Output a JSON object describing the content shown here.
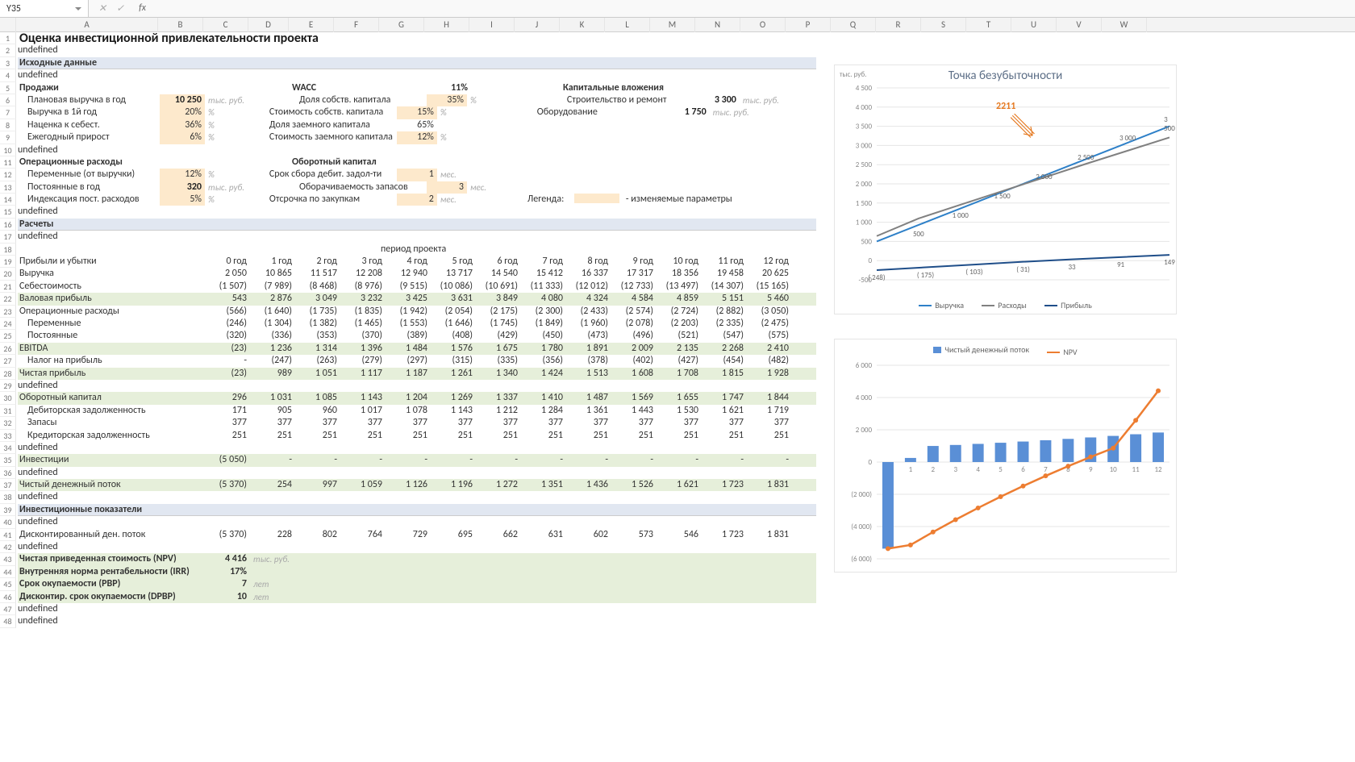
{
  "namebox": "Y35",
  "title": "Оценка инвестиционной привлекательности проекта",
  "sections": {
    "src": "Исходные данные",
    "calc": "Расчеты",
    "period": "период проекта",
    "inv_ind": "Инвестиционные показатели"
  },
  "sales": {
    "h": "Продажи",
    "rev_plan": "Плановая выручка в год",
    "rev_plan_v": "10 250",
    "rev_plan_u": "тыс. руб.",
    "rev_y1": "Выручка в 1й год",
    "rev_y1_v": "20%",
    "rev_y1_u": "%",
    "markup": "Наценка к себест.",
    "markup_v": "36%",
    "markup_u": "%",
    "growth": "Ежегодный прирост",
    "growth_v": "6%",
    "growth_u": "%"
  },
  "opex": {
    "h": "Операционные расходы",
    "var": "Переменные (от выручки)",
    "var_v": "12%",
    "var_u": "%",
    "fix": "Постоянные в год",
    "fix_v": "320",
    "fix_u": "тыс. руб.",
    "idx": "Индексация пост. расходов",
    "idx_v": "5%",
    "idx_u": "%"
  },
  "wacc": {
    "h": "WACC",
    "v": "11%",
    "eq_share": "Доля собств. капитала",
    "eq_share_v": "35%",
    "eq_share_u": "%",
    "eq_cost": "Стоимость собств. капитала",
    "eq_cost_v": "15%",
    "eq_cost_u": "%",
    "dt_share": "Доля заемного капитала",
    "dt_share_v": "65%",
    "dt_cost": "Стоимость заемного капитала",
    "dt_cost_v": "12%",
    "dt_cost_u": "%"
  },
  "wc": {
    "h": "Оборотный капитал",
    "ar": "Срок сбора дебит. задол-ти",
    "ar_v": "1",
    "ar_u": "мес.",
    "inv": "Оборачиваемость запасов",
    "inv_v": "3",
    "inv_u": "мес.",
    "ap": "Отсрочка по  закупкам",
    "ap_v": "2",
    "ap_u": "мес."
  },
  "capex": {
    "h": "Капитальные вложения",
    "constr": "Строительство и ремонт",
    "constr_v": "3 300",
    "constr_u": "тыс. руб.",
    "equip": "Оборудование",
    "equip_v": "1 750",
    "equip_u": "тыс. руб."
  },
  "legend": {
    "lbl": "Легенда:",
    "txt": "- изменяемые параметры"
  },
  "yrs": [
    "0 год",
    "1 год",
    "2 год",
    "3 год",
    "4 год",
    "5 год",
    "6 год",
    "7 год",
    "8 год",
    "9 год",
    "10 год",
    "11 год",
    "12 год"
  ],
  "pl": {
    "h": "Прибыли и убытки",
    "rev": "Выручка",
    "rev_v": [
      "",
      "2 050",
      "10 865",
      "11 517",
      "12 208",
      "12 940",
      "13 717",
      "14 540",
      "15 412",
      "16 337",
      "17 317",
      "18 356",
      "19 458",
      "20 625"
    ],
    "cogs": "Себестоимость",
    "cogs_v": [
      "",
      "(1 507)",
      "(7 989)",
      "(8 468)",
      "(8 976)",
      "(9 515)",
      "(10 086)",
      "(10 691)",
      "(11 333)",
      "(12 012)",
      "(12 733)",
      "(13 497)",
      "(14 307)",
      "(15 165)"
    ],
    "gp": "Валовая прибыль",
    "gp_v": [
      "",
      "543",
      "2 876",
      "3 049",
      "3 232",
      "3 425",
      "3 631",
      "3 849",
      "4 080",
      "4 324",
      "4 584",
      "4 859",
      "5 151",
      "5 460"
    ],
    "ox": "Операционные расходы",
    "ox_v": [
      "",
      "(566)",
      "(1 640)",
      "(1 735)",
      "(1 835)",
      "(1 942)",
      "(2 054)",
      "(2 175)",
      "(2 300)",
      "(2 433)",
      "(2 574)",
      "(2 724)",
      "(2 882)",
      "(3 050)"
    ],
    "var": "Переменные",
    "var_v": [
      "",
      "(246)",
      "(1 304)",
      "(1 382)",
      "(1 465)",
      "(1 553)",
      "(1 646)",
      "(1 745)",
      "(1 849)",
      "(1 960)",
      "(2 078)",
      "(2 203)",
      "(2 335)",
      "(2 475)"
    ],
    "fix": "Постоянные",
    "fix_v": [
      "",
      "(320)",
      "(336)",
      "(353)",
      "(370)",
      "(389)",
      "(408)",
      "(429)",
      "(450)",
      "(473)",
      "(496)",
      "(521)",
      "(547)",
      "(575)"
    ],
    "ebit": "EBITDA",
    "ebit_v": [
      "",
      "(23)",
      "1 236",
      "1 314",
      "1 396",
      "1 484",
      "1 576",
      "1 675",
      "1 780",
      "1 891",
      "2 009",
      "2 135",
      "2 268",
      "2 410"
    ],
    "tax": "Налог на прибыль",
    "tax_v": [
      "",
      "-",
      "(247)",
      "(263)",
      "(279)",
      "(297)",
      "(315)",
      "(335)",
      "(356)",
      "(378)",
      "(402)",
      "(427)",
      "(454)",
      "(482)"
    ],
    "np": "Чистая прибыль",
    "np_v": [
      "",
      "(23)",
      "989",
      "1 051",
      "1 117",
      "1 187",
      "1 261",
      "1 340",
      "1 424",
      "1 513",
      "1 608",
      "1 708",
      "1 815",
      "1 928"
    ]
  },
  "wc2": {
    "h": "Оборотный капитал",
    "v": [
      "",
      "296",
      "1 031",
      "1 085",
      "1 143",
      "1 204",
      "1 269",
      "1 337",
      "1 410",
      "1 487",
      "1 569",
      "1 655",
      "1 747",
      "1 844"
    ],
    "ar": "Дебиторская задолженность",
    "ar_v": [
      "",
      "171",
      "905",
      "960",
      "1 017",
      "1 078",
      "1 143",
      "1 212",
      "1 284",
      "1 361",
      "1 443",
      "1 530",
      "1 621",
      "1 719"
    ],
    "inv": "Запасы",
    "inv_v": [
      "",
      "377",
      "377",
      "377",
      "377",
      "377",
      "377",
      "377",
      "377",
      "377",
      "377",
      "377",
      "377",
      "377"
    ],
    "ap": "Кредиторская задолженность",
    "ap_v": [
      "",
      "251",
      "251",
      "251",
      "251",
      "251",
      "251",
      "251",
      "251",
      "251",
      "251",
      "251",
      "251",
      "251"
    ]
  },
  "inv": {
    "h": "Инвестиции",
    "v": [
      "(5 050)",
      "-",
      "-",
      "-",
      "-",
      "-",
      "-",
      "-",
      "-",
      "-",
      "-",
      "-",
      "-",
      "-"
    ]
  },
  "fcf": {
    "h": "Чистый денежный поток",
    "v": [
      "(5 370)",
      "254",
      "997",
      "1 059",
      "1 126",
      "1 196",
      "1 272",
      "1 351",
      "1 436",
      "1 526",
      "1 621",
      "1 723",
      "1 831",
      ""
    ]
  },
  "dcf": {
    "h": "Дисконтированный ден. поток",
    "v": [
      "(5 370)",
      "228",
      "802",
      "764",
      "729",
      "695",
      "662",
      "631",
      "602",
      "573",
      "546",
      "1 723",
      "1 831",
      ""
    ]
  },
  "kpi": {
    "npv_l": "Чистая приведенная стоимость (NPV)",
    "npv_v": "4 416",
    "npv_u": "тыс. руб.",
    "irr_l": "Внутренняя норма рентабельности (IRR)",
    "irr_v": "17%",
    "pbp_l": "Срок окупаемости (PBP)",
    "pbp_v": "7",
    "pbp_u": "лет",
    "dpbp_l": "Дисконтир. срок окупаемости (DPBP)",
    "dpbp_v": "10",
    "dpbp_u": "лет"
  },
  "chart_data": [
    {
      "type": "line",
      "title": "Точка безубыточности",
      "ylabel": "тыс. руб.",
      "ylim": [
        -500,
        4500
      ],
      "x": [
        0,
        1,
        2,
        3,
        4,
        5,
        6,
        7
      ],
      "series": [
        {
          "name": "Выручка",
          "values": [
            500,
            1000,
            1500,
            2000,
            2500,
            3000,
            3500
          ],
          "color": "#2e80c8"
        },
        {
          "name": "Расходы",
          "values": [
            640,
            1098,
            1455,
            1810,
            2165,
            2520,
            2864,
            3210
          ],
          "color": "#808080"
        },
        {
          "name": "Прибыль",
          "values": [
            -248,
            -175,
            -103,
            -31,
            33,
            91,
            149
          ],
          "color": "#1f4e89"
        }
      ],
      "callout": "2211",
      "data_labels": {
        "Выручка": [
          "",
          "500",
          "1 000",
          "1 500",
          "2 000",
          "2 500",
          "3 000",
          "3 500"
        ],
        "Прибыль": [
          "( 248)",
          "( 175)",
          "( 103)",
          "( 31)",
          "33",
          "91",
          "149"
        ]
      }
    },
    {
      "type": "combo",
      "ylim": [
        -6000,
        6000
      ],
      "x": [
        0,
        1,
        2,
        3,
        4,
        5,
        6,
        7,
        8,
        9,
        10,
        11,
        12
      ],
      "series": [
        {
          "name": "Чистый денежный поток",
          "type": "bar",
          "color": "#5a8fd6",
          "values": [
            -5370,
            254,
            997,
            1059,
            1126,
            1196,
            1272,
            1351,
            1436,
            1526,
            1621,
            1723,
            1831
          ]
        },
        {
          "name": "NPV",
          "type": "line",
          "color": "#ed7d31",
          "values": [
            -5370,
            -5142,
            -4340,
            -3576,
            -2847,
            -2152,
            -1490,
            -859,
            -257,
            316,
            862,
            2585,
            4416
          ]
        }
      ]
    }
  ],
  "colW": {
    "A": 176,
    "C": 56,
    "D": 56,
    "yr": 56
  },
  "cols": [
    "A",
    "B",
    "C",
    "D",
    "E",
    "F",
    "G",
    "H",
    "I",
    "J",
    "K",
    "L",
    "M",
    "N",
    "O",
    "P",
    "Q",
    "R",
    "S",
    "T",
    "U",
    "V",
    "W"
  ]
}
